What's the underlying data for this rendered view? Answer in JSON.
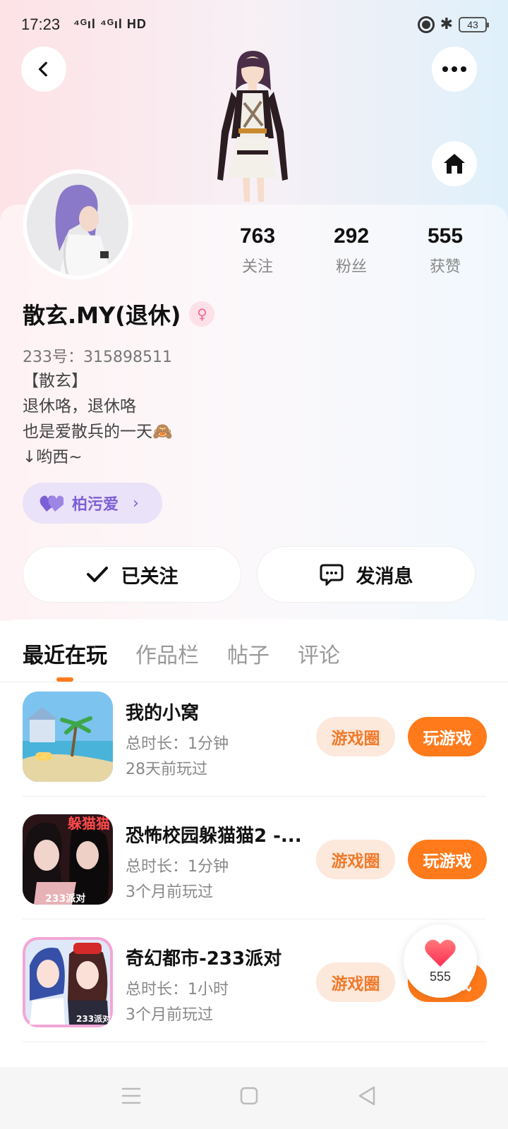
{
  "status_bar": {
    "time": "17:23",
    "signal": "⁴ᴳıl ⁴ᴳıl HD",
    "battery": "43"
  },
  "profile": {
    "name": "散玄.MY(退休)",
    "uid": "233号：315898511",
    "bio": [
      "【散玄】",
      "退休咯，退休咯",
      "也是爱散兵的一天🙈",
      "↓哟西~"
    ],
    "tag": "柏污爱",
    "stats": [
      {
        "num": "763",
        "label": "关注"
      },
      {
        "num": "292",
        "label": "粉丝"
      },
      {
        "num": "555",
        "label": "获赞"
      }
    ]
  },
  "actions": {
    "followed": "已关注",
    "message": "发消息"
  },
  "tabs": [
    "最近在玩",
    "作品栏",
    "帖子",
    "评论"
  ],
  "games": [
    {
      "title": "我的小窝",
      "duration": "总时长：1分钟",
      "last": "28天前玩过",
      "circle": "游戏圈",
      "play": "玩游戏"
    },
    {
      "title": "恐怖校园躲猫猫2 -...",
      "duration": "总时长：1分钟",
      "last": "3个月前玩过",
      "circle": "游戏圈",
      "play": "玩游戏"
    },
    {
      "title": "奇幻都市-233派对",
      "duration": "总时长：1小时",
      "last": "3个月前玩过",
      "circle": "游戏圈",
      "play": "玩游戏"
    }
  ],
  "icon_labels": {
    "game2_badge": "躲猫猫",
    "game2_logo": "233派对",
    "game3_logo": "233派对"
  },
  "like_count": "555",
  "colors": {
    "accent": "#ff7a1a",
    "purple": "#7c5fd6",
    "pink": "#f36b94"
  }
}
